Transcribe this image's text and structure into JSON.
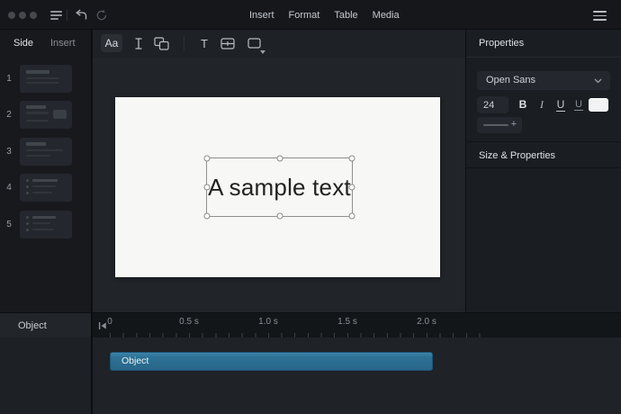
{
  "topbar": {
    "menus": [
      "Insert",
      "Format",
      "Table",
      "Media"
    ],
    "icons": {
      "window_controls": "three-dots",
      "menu": "stacked-lines",
      "undo": "arrow-hook-left",
      "redo": "circular-arrow",
      "overflow": "hamburger"
    }
  },
  "sidebar": {
    "tabs": {
      "side": "Side",
      "insert": "Insert"
    },
    "slides": [
      {
        "number": "1"
      },
      {
        "number": "2"
      },
      {
        "number": "3"
      },
      {
        "number": "4"
      },
      {
        "number": "5"
      }
    ]
  },
  "toolbar": {
    "text_style_label": "Aa",
    "text_tool_label": "T",
    "icons": {
      "text_cursor": "i-beam",
      "shapes": "overlapping-squares",
      "table_field": "split-rect",
      "shape_dropdown": "rect-with-caret"
    }
  },
  "canvas": {
    "slide_text": "A sample text"
  },
  "properties": {
    "title": "Properties",
    "font_family": "Open Sans",
    "font_size": "24",
    "bold_label": "B",
    "italic_label": "I",
    "underline_label": "U",
    "underline_alt_label": "U",
    "plus_label": "+",
    "swatch_color": "#f2f3f4",
    "size_section_title": "Size & Properties"
  },
  "timeline": {
    "row_label": "Object",
    "bar_label": "Object",
    "tick_labels": [
      "0",
      "0.5 s",
      "1.0 s",
      "1.5 s",
      "2.0 s"
    ],
    "bar_color": "#2d7295"
  }
}
